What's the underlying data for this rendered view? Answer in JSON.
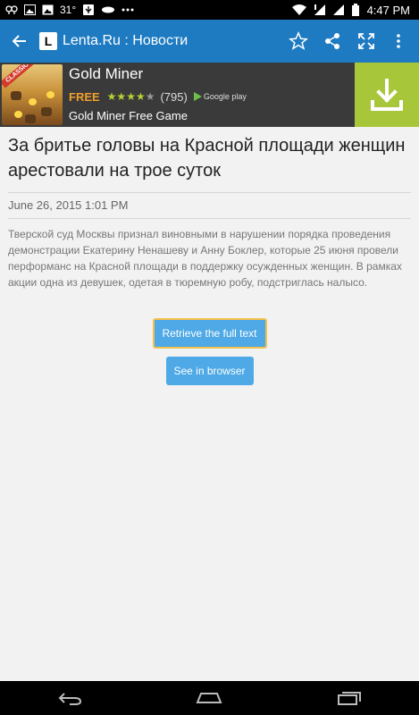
{
  "status_bar": {
    "temperature": "31°",
    "time": "4:47 PM",
    "left_icons": [
      "cloud-icon",
      "image-icon",
      "picture-icon",
      "temperature",
      "usb-icon",
      "drive-icon",
      "more-icon"
    ],
    "right_icons": [
      "wifi-icon",
      "signal-icon",
      "signal-icon",
      "battery-icon"
    ]
  },
  "action_bar": {
    "app_logo": "L",
    "title": "Lenta.Ru : Новости",
    "color": "#1e7bc1"
  },
  "ad": {
    "image_badge": "CLASSIC",
    "title": "Gold Miner",
    "price": "FREE",
    "rating_stars": 4,
    "rating_count": "(795)",
    "store": "Google play",
    "subtitle": "Gold Miner Free Game"
  },
  "article": {
    "headline": "За бритье головы на Красной площади женщин арестовали на трое суток",
    "date": "June 26, 2015 1:01 PM",
    "body": "Тверской суд Москвы признал виновными в нарушении порядка проведения демонстрации Екатерину Ненашеву и Анну Боклер, которые 25 июня провели перформанс на Красной площади в поддержку осужденных женщин. В рамках акции одна из девушек, одетая в тюремную робу, подстриглась налысо."
  },
  "buttons": {
    "retrieve": "Retrieve the full text",
    "browser": "See in browser"
  }
}
